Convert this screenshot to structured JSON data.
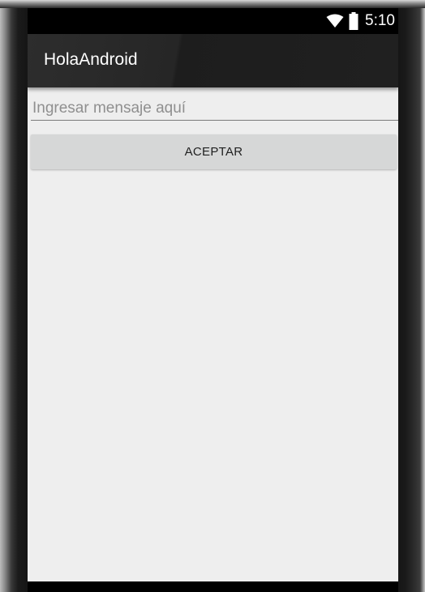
{
  "status_bar": {
    "time": "5:10",
    "icons": [
      "wifi-icon",
      "battery-icon"
    ]
  },
  "app_bar": {
    "title": "HolaAndroid"
  },
  "form": {
    "message_input": {
      "placeholder": "Ingresar mensaje aquí",
      "value": ""
    },
    "accept_label": "ACEPTAR"
  },
  "colors": {
    "status_bar": "#000000",
    "app_bar": "#212121",
    "background": "#eeeeee",
    "button": "#d6d7d7"
  }
}
